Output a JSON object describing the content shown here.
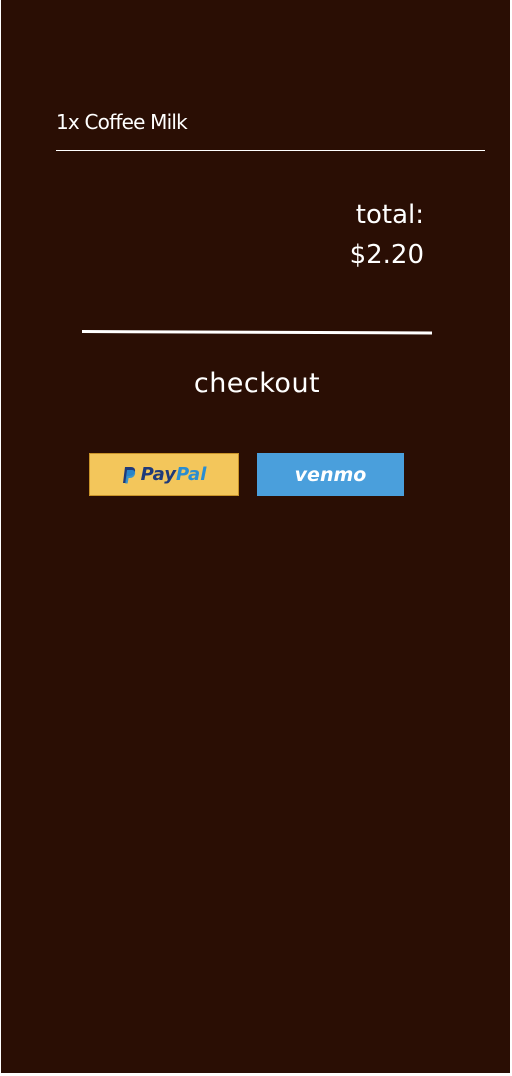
{
  "cart": {
    "items": [
      {
        "label": "1x Coffee Milk"
      }
    ]
  },
  "summary": {
    "total_label": "total:",
    "total_value": "$2.20"
  },
  "checkout": {
    "title": "checkout"
  },
  "payment_methods": {
    "paypal": {
      "part1": "Pay",
      "part2": "Pal",
      "icon": "paypal-icon"
    },
    "venmo": {
      "label": "venmo"
    }
  },
  "colors": {
    "background": "#2a0e04",
    "paypal_yellow": "#f3c65b",
    "paypal_dark_blue": "#1f3a7a",
    "paypal_light_blue": "#2a8dd1",
    "venmo_blue": "#4a9fdc"
  }
}
